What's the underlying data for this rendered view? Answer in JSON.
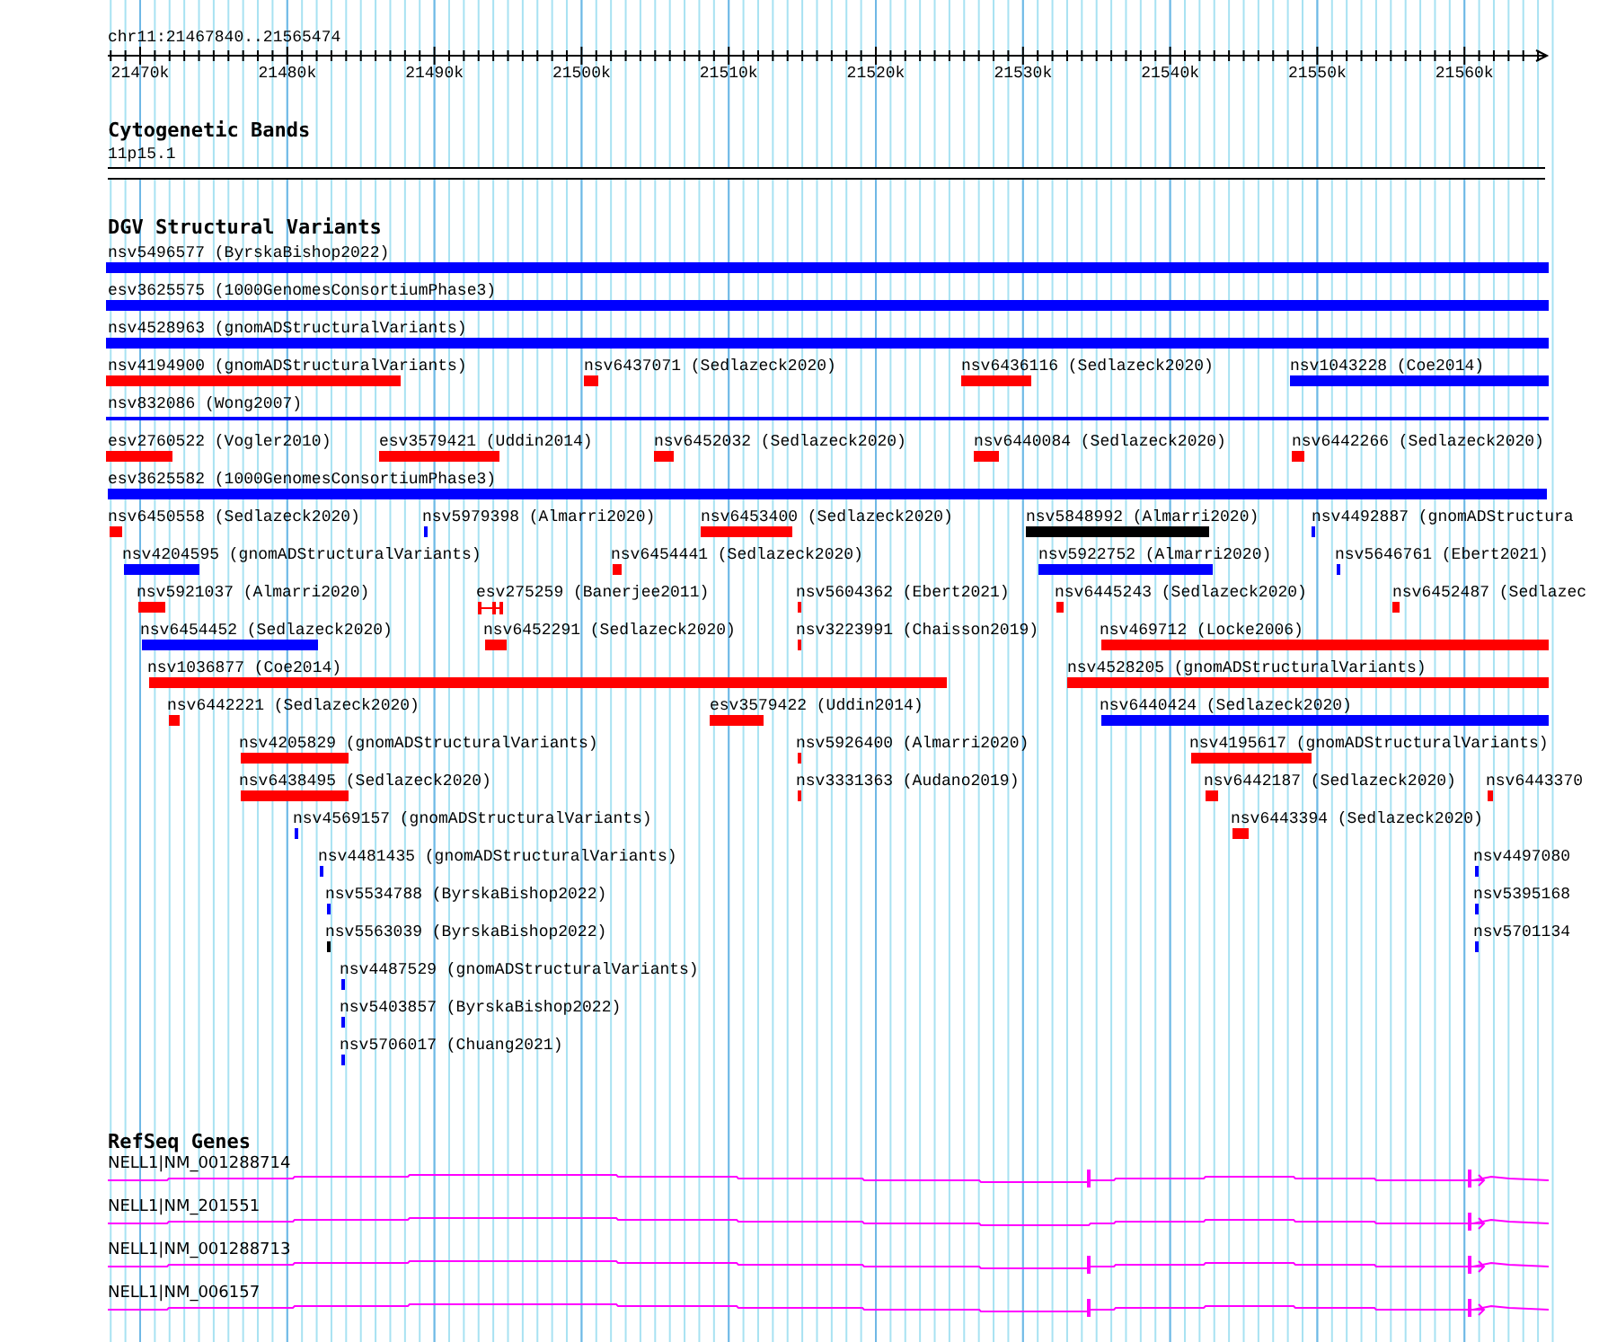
{
  "ruler": {
    "location": "chr11:21467840..21565474",
    "tick_labels": [
      "21470k",
      "21480k",
      "21490k",
      "21500k",
      "21510k",
      "21520k",
      "21530k",
      "21540k",
      "21550k",
      "21560k"
    ]
  },
  "tracks": [
    {
      "title": "Cytogenetic Bands",
      "kind": "bands",
      "bands": [
        {
          "name": "11p15.1"
        }
      ]
    },
    {
      "title": "DGV Structural Variants",
      "kind": "variants",
      "features": [
        {
          "label": "nsv5496577 (ByrskaBishop2022)",
          "color": "#0000ff",
          "kind": "bar"
        },
        {
          "label": "esv3625575 (1000GenomesConsortiumPhase3)",
          "color": "#0000ff",
          "kind": "bar"
        },
        {
          "label": "nsv4528963 (gnomADStructuralVariants)",
          "color": "#0000ff",
          "kind": "bar"
        },
        {
          "label": "nsv4194900 (gnomADStructuralVariants)",
          "color": "#ff0000",
          "kind": "bar"
        },
        {
          "label": "nsv6437071 (Sedlazeck2020)",
          "color": "#ff0000",
          "kind": "bar"
        },
        {
          "label": "nsv6436116 (Sedlazeck2020)",
          "color": "#ff0000",
          "kind": "bar"
        },
        {
          "label": "nsv1043228 (Coe2014)",
          "color": "#0000ff",
          "kind": "bar"
        },
        {
          "label": "nsv832086 (Wong2007)",
          "color": "#0000ff",
          "kind": "line"
        },
        {
          "label": "esv2760522 (Vogler2010)",
          "color": "#ff0000",
          "kind": "bar"
        },
        {
          "label": "esv3579421 (Uddin2014)",
          "color": "#ff0000",
          "kind": "bar"
        },
        {
          "label": "nsv6452032 (Sedlazeck2020)",
          "color": "#ff0000",
          "kind": "bar"
        },
        {
          "label": "nsv6440084 (Sedlazeck2020)",
          "color": "#ff0000",
          "kind": "bar"
        },
        {
          "label": "nsv6442266 (Sedlazeck2020)",
          "color": "#ff0000",
          "kind": "bar"
        },
        {
          "label": "esv3625582 (1000GenomesConsortiumPhase3)",
          "color": "#0000ff",
          "kind": "bar"
        },
        {
          "label": "nsv6450558 (Sedlazeck2020)",
          "color": "#ff0000",
          "kind": "bar"
        },
        {
          "label": "nsv5979398 (Almarri2020)",
          "color": "#0000ff",
          "kind": "bar"
        },
        {
          "label": "nsv6453400 (Sedlazeck2020)",
          "color": "#ff0000",
          "kind": "bar"
        },
        {
          "label": "nsv5848992 (Almarri2020)",
          "color": "#000000",
          "kind": "bar"
        },
        {
          "label": "nsv4492887 (gnomADStructura",
          "color": "#0000ff",
          "kind": "bar"
        },
        {
          "label": "nsv4204595 (gnomADStructuralVariants)",
          "color": "#0000ff",
          "kind": "bar"
        },
        {
          "label": "nsv6454441 (Sedlazeck2020)",
          "color": "#ff0000",
          "kind": "bar"
        },
        {
          "label": "nsv5922752 (Almarri2020)",
          "color": "#0000ff",
          "kind": "bar"
        },
        {
          "label": "nsv5646761 (Ebert2021)",
          "color": "#0000ff",
          "kind": "bar"
        },
        {
          "label": "nsv5921037 (Almarri2020)",
          "color": "#ff0000",
          "kind": "bar"
        },
        {
          "label": "esv275259 (Banerjee2011)",
          "color": "#ff0000",
          "kind": "interval"
        },
        {
          "label": "nsv5604362 (Ebert2021)",
          "color": "#ff0000",
          "kind": "bar"
        },
        {
          "label": "nsv6445243 (Sedlazeck2020)",
          "color": "#ff0000",
          "kind": "bar"
        },
        {
          "label": "nsv6452487 (Sedlazec",
          "color": "#ff0000",
          "kind": "bar"
        },
        {
          "label": "nsv6454452 (Sedlazeck2020)",
          "color": "#0000ff",
          "kind": "bar"
        },
        {
          "label": "nsv6452291 (Sedlazeck2020)",
          "color": "#ff0000",
          "kind": "bar"
        },
        {
          "label": "nsv3223991 (Chaisson2019)",
          "color": "#ff0000",
          "kind": "bar"
        },
        {
          "label": "nsv469712 (Locke2006)",
          "color": "#ff0000",
          "kind": "bar"
        },
        {
          "label": "nsv1036877 (Coe2014)",
          "color": "#ff0000",
          "kind": "bar"
        },
        {
          "label": "nsv4528205 (gnomADStructuralVariants)",
          "color": "#ff0000",
          "kind": "bar"
        },
        {
          "label": "nsv6442221 (Sedlazeck2020)",
          "color": "#ff0000",
          "kind": "bar"
        },
        {
          "label": "esv3579422 (Uddin2014)",
          "color": "#ff0000",
          "kind": "bar"
        },
        {
          "label": "nsv6440424 (Sedlazeck2020)",
          "color": "#0000ff",
          "kind": "bar"
        },
        {
          "label": "nsv4205829 (gnomADStructuralVariants)",
          "color": "#ff0000",
          "kind": "bar"
        },
        {
          "label": "nsv5926400 (Almarri2020)",
          "color": "#ff0000",
          "kind": "bar"
        },
        {
          "label": "nsv4195617 (gnomADStructuralVariants)",
          "color": "#ff0000",
          "kind": "bar"
        },
        {
          "label": "nsv6438495 (Sedlazeck2020)",
          "color": "#ff0000",
          "kind": "bar"
        },
        {
          "label": "nsv3331363 (Audano2019)",
          "color": "#ff0000",
          "kind": "bar"
        },
        {
          "label": "nsv6442187 (Sedlazeck2020)",
          "color": "#ff0000",
          "kind": "bar"
        },
        {
          "label": "nsv6443370",
          "color": "#ff0000",
          "kind": "bar"
        },
        {
          "label": "nsv4569157 (gnomADStructuralVariants)",
          "color": "#0000ff",
          "kind": "bar"
        },
        {
          "label": "nsv6443394 (Sedlazeck2020)",
          "color": "#ff0000",
          "kind": "bar"
        },
        {
          "label": "nsv4481435 (gnomADStructuralVariants)",
          "color": "#0000ff",
          "kind": "bar"
        },
        {
          "label": "nsv4497080",
          "color": "#0000ff",
          "kind": "bar"
        },
        {
          "label": "nsv5534788 (ByrskaBishop2022)",
          "color": "#0000ff",
          "kind": "bar"
        },
        {
          "label": "nsv5395168",
          "color": "#0000ff",
          "kind": "bar"
        },
        {
          "label": "nsv5563039 (ByrskaBishop2022)",
          "color": "#000000",
          "kind": "bar"
        },
        {
          "label": "nsv5701134",
          "color": "#0000ff",
          "kind": "bar"
        },
        {
          "label": "nsv4487529 (gnomADStructuralVariants)",
          "color": "#0000ff",
          "kind": "bar"
        },
        {
          "label": "nsv5403857 (ByrskaBishop2022)",
          "color": "#0000ff",
          "kind": "bar"
        },
        {
          "label": "nsv5706017 (Chuang2021)",
          "color": "#0000ff",
          "kind": "bar"
        }
      ]
    },
    {
      "title": "RefSeq Genes",
      "kind": "genes",
      "genes": [
        {
          "label": "NELL1|NM_001288714"
        },
        {
          "label": "NELL1|NM_201551"
        },
        {
          "label": "NELL1|NM_001288713"
        },
        {
          "label": "NELL1|NM_006157"
        }
      ]
    }
  ]
}
